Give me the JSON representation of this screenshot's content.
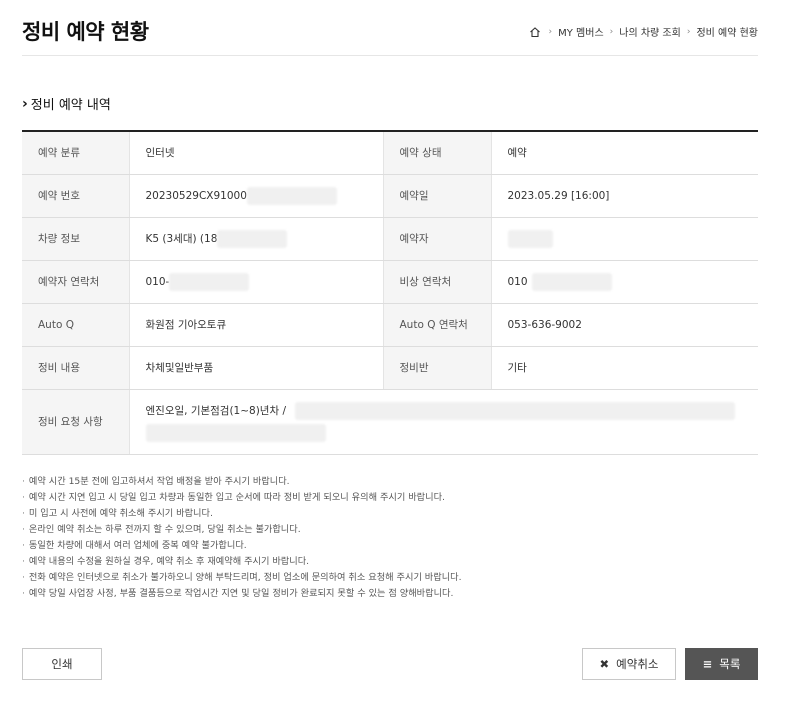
{
  "header": {
    "title": "정비 예약 현황",
    "breadcrumb": [
      "MY 멤버스",
      "나의 차량 조회",
      "정비 예약 현황"
    ]
  },
  "section": {
    "title": "정비 예약 내역"
  },
  "table": {
    "reservation_type_label": "예약 분류",
    "reservation_type_value": "인터넷",
    "reservation_status_label": "예약 상태",
    "reservation_status_value": "예약",
    "reservation_number_label": "예약 번호",
    "reservation_number_value": "20230529CX91000",
    "reservation_date_label": "예약일",
    "reservation_date_value": "2023.05.29 [16:00]",
    "vehicle_label": "차량 정보",
    "vehicle_value": "K5 (3세대) (18",
    "reserver_label": "예약자",
    "reserver_value": "",
    "reserver_contact_label": "예약자 연락처",
    "reserver_contact_value": "010-",
    "emergency_contact_label": "비상 연락처",
    "emergency_contact_value": "010",
    "autoq_label": "Auto Q",
    "autoq_value": "화원점 기아오토큐",
    "autoq_contact_label": "Auto Q 연락처",
    "autoq_contact_value": "053-636-9002",
    "service_content_label": "정비 내용",
    "service_content_value": "차체및일반부품",
    "service_team_label": "정비반",
    "service_team_value": "기타",
    "request_label": "정비 요청 사항",
    "request_value": "엔진오일, 기본점검(1~8)년차 /"
  },
  "notes": [
    "예약 시간 15분 전에 입고하셔서 작업 배정을 받아 주시기 바랍니다.",
    "예약 시간 지연 입고 시 당일 입고 차량과 동일한 입고 순서에 따라 정비 받게 되오니 유의해 주시기 바랍니다.",
    "미 입고 시 사전에 예약 취소해 주시기 바랍니다.",
    "온라인 예약 취소는 하루 전까지 할 수 있으며, 당일 취소는 불가합니다.",
    "동일한 차량에 대해서 여러 업체에 중복 예약 불가합니다.",
    "예약 내용의 수정을 원하실 경우, 예약 취소 후 재예약해 주시기 바랍니다.",
    "전화 예약은 인터넷으로 취소가 불가하오니 양해 부탁드리며, 정비 업소에 문의하여 취소 요청해 주시기 바랍니다.",
    "예약 당일 사업장 사정, 부품 결품등으로 작업시간 지연 및 당일 정비가 완료되지 못할 수 있는 점 양해바랍니다."
  ],
  "buttons": {
    "print": "인쇄",
    "cancel": "예약취소",
    "list": "목록"
  },
  "colors": {
    "status_accent": "#c8102e",
    "list_button": "#555555"
  }
}
